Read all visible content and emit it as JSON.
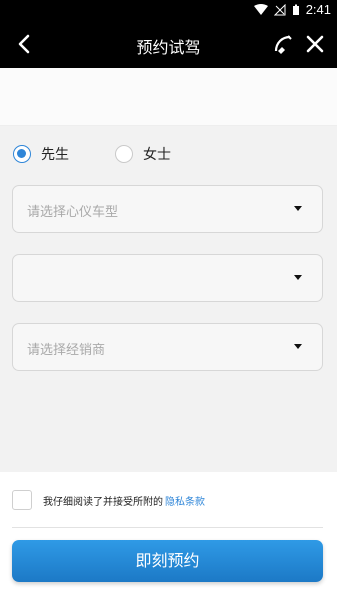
{
  "status_bar": {
    "time": "2:41",
    "icons": [
      "wifi-icon",
      "signal-icon",
      "battery-icon"
    ]
  },
  "titlebar": {
    "title": "预约试驾",
    "back_icon": "chevron-left-icon",
    "call_icon": "phone-icon",
    "close_icon": "close-icon"
  },
  "gender": {
    "options": [
      {
        "label": "先生",
        "selected": true
      },
      {
        "label": "女士",
        "selected": false
      }
    ]
  },
  "selects": {
    "car_model_placeholder": "请选择心仪车型",
    "second_value": "",
    "dealer_placeholder": "请选择经销商"
  },
  "agreement": {
    "text": "我仔细阅读了并接受所附的",
    "link": "隐私条款"
  },
  "submit_label": "即刻预约",
  "colors": {
    "accent": "#2f86d8",
    "header_bg": "#000000",
    "form_bg": "#f2f2f2"
  }
}
